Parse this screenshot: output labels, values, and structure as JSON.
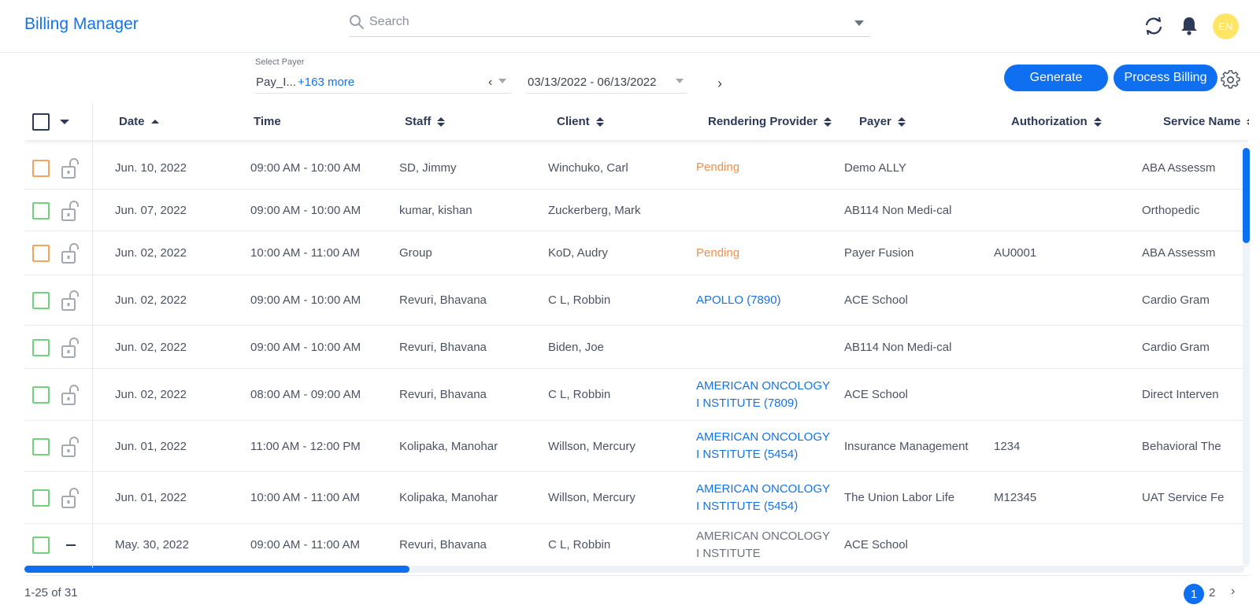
{
  "app": {
    "title": "Billing Manager"
  },
  "header": {
    "search_placeholder": "Search",
    "avatar_initials": "EN",
    "avatar_color": "#ffe566",
    "accent_color": "#1673e6"
  },
  "filters": {
    "payer_label": "Select Payer",
    "payer_value": "Pay_I...",
    "payer_more": "+163 more",
    "date_range": "03/13/2022 - 06/13/2022"
  },
  "actions": {
    "generate": "Generate",
    "process_billing": "Process Billing"
  },
  "table": {
    "columns": [
      "Date",
      "Time",
      "Staff",
      "Client",
      "Rendering Provider",
      "Payer",
      "Authorization",
      "Service Name"
    ],
    "rows": [
      {
        "check": "orange",
        "icon": "lock",
        "date": "Jun. 10, 2022",
        "time": "09:00 AM - 10:00 AM",
        "staff": "SD, Jimmy",
        "client": "Winchuko, Carl",
        "provider": "Pending",
        "provider_style": "pending",
        "payer": "Demo ALLY",
        "authorization": "",
        "service": "ABA Assessm"
      },
      {
        "check": "green",
        "icon": "lock",
        "date": "Jun. 07, 2022",
        "time": "09:00 AM - 10:00 AM",
        "staff": "kumar, kishan",
        "client": "Zuckerberg, Mark",
        "provider": "",
        "provider_style": "",
        "payer": "AB114 Non Medi-cal",
        "authorization": "",
        "service": "Orthopedic"
      },
      {
        "check": "orange",
        "icon": "lock",
        "date": "Jun. 02, 2022",
        "time": "10:00 AM - 11:00 AM",
        "staff": "Group",
        "client": "KoD, Audry",
        "provider": "Pending",
        "provider_style": "pending",
        "payer": "Payer Fusion",
        "authorization": "AU0001",
        "service": "ABA Assessm"
      },
      {
        "check": "green",
        "icon": "lock",
        "date": "Jun. 02, 2022",
        "time": "09:00 AM - 10:00 AM",
        "staff": "Revuri, Bhavana",
        "client": "C L, Robbin",
        "provider": "APOLLO (7890)",
        "provider_style": "link",
        "payer": "ACE School",
        "authorization": "",
        "service": "Cardio Gram"
      },
      {
        "check": "green",
        "icon": "lock",
        "date": "Jun. 02, 2022",
        "time": "09:00 AM - 10:00 AM",
        "staff": "Revuri, Bhavana",
        "client": "Biden, Joe",
        "provider": "",
        "provider_style": "",
        "payer": "AB114 Non Medi-cal",
        "authorization": "",
        "service": "Cardio Gram"
      },
      {
        "check": "green",
        "icon": "lock",
        "date": "Jun. 02, 2022",
        "time": "08:00 AM - 09:00 AM",
        "staff": "Revuri, Bhavana",
        "client": "C L, Robbin",
        "provider": "AMERICAN ONCOLOGY I NSTITUTE (7809)",
        "provider_style": "link",
        "payer": "ACE School",
        "authorization": "",
        "service": "Direct Interven"
      },
      {
        "check": "green",
        "icon": "lock",
        "date": "Jun. 01, 2022",
        "time": "11:00 AM - 12:00 PM",
        "staff": "Kolipaka, Manohar",
        "client": "Willson, Mercury",
        "provider": "AMERICAN ONCOLOGY I NSTITUTE (5454)",
        "provider_style": "link",
        "payer": "Insurance Management",
        "authorization": "1234",
        "service": "Behavioral The"
      },
      {
        "check": "green",
        "icon": "lock",
        "date": "Jun. 01, 2022",
        "time": "10:00 AM - 11:00 AM",
        "staff": "Kolipaka, Manohar",
        "client": "Willson, Mercury",
        "provider": "AMERICAN ONCOLOGY I NSTITUTE (5454)",
        "provider_style": "link",
        "payer": "The Union Labor Life",
        "authorization": "M12345",
        "service": "UAT Service Fe"
      },
      {
        "check": "green",
        "icon": "dash",
        "date": "May. 30, 2022",
        "time": "09:00 AM - 11:00 AM",
        "staff": "Revuri, Bhavana",
        "client": "C L, Robbin",
        "provider": "AMERICAN ONCOLOGY I NSTITUTE",
        "provider_style": "plain",
        "payer": "ACE School",
        "authorization": "",
        "service": ""
      }
    ]
  },
  "pagination": {
    "range": "1-25 of 31",
    "pages": [
      "1",
      "2"
    ],
    "current": "1"
  }
}
